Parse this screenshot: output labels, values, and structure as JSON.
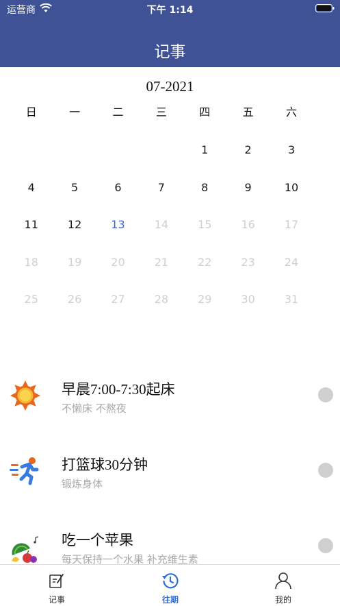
{
  "status_bar": {
    "carrier": "运营商",
    "time": "下午 1:14"
  },
  "nav": {
    "title": "记事"
  },
  "calendar": {
    "month": "07-2021",
    "weekdays": [
      "日",
      "一",
      "二",
      "三",
      "四",
      "五",
      "六"
    ],
    "past_days": [
      "1",
      "2",
      "3",
      "4",
      "5",
      "6",
      "7",
      "8",
      "9",
      "10",
      "11",
      "12"
    ],
    "today": "13",
    "future_days": [
      "14",
      "15",
      "16",
      "17",
      "18",
      "19",
      "20",
      "21",
      "22",
      "23",
      "24",
      "25",
      "26",
      "27",
      "28",
      "29",
      "30",
      "31"
    ]
  },
  "tasks": [
    {
      "title": "早晨7:00-7:30起床",
      "subtitle": "不懒床 不熬夜",
      "icon": "sun-icon"
    },
    {
      "title": "打篮球30分钟",
      "subtitle": "锻炼身体",
      "icon": "runner-icon"
    },
    {
      "title": "吃一个苹果",
      "subtitle": "每天保持一个水果 补充维生素",
      "icon": "fruit-icon"
    }
  ],
  "tabbar": {
    "items": [
      {
        "label": "记事",
        "icon": "note-edit-icon",
        "active": false
      },
      {
        "label": "往期",
        "icon": "history-icon",
        "active": true
      },
      {
        "label": "我的",
        "icon": "profile-icon",
        "active": false
      }
    ]
  },
  "colors": {
    "header": "#3f5295",
    "accent": "#2f6fd6",
    "today": "#3d63d6",
    "muted": "#cfcfcf"
  }
}
